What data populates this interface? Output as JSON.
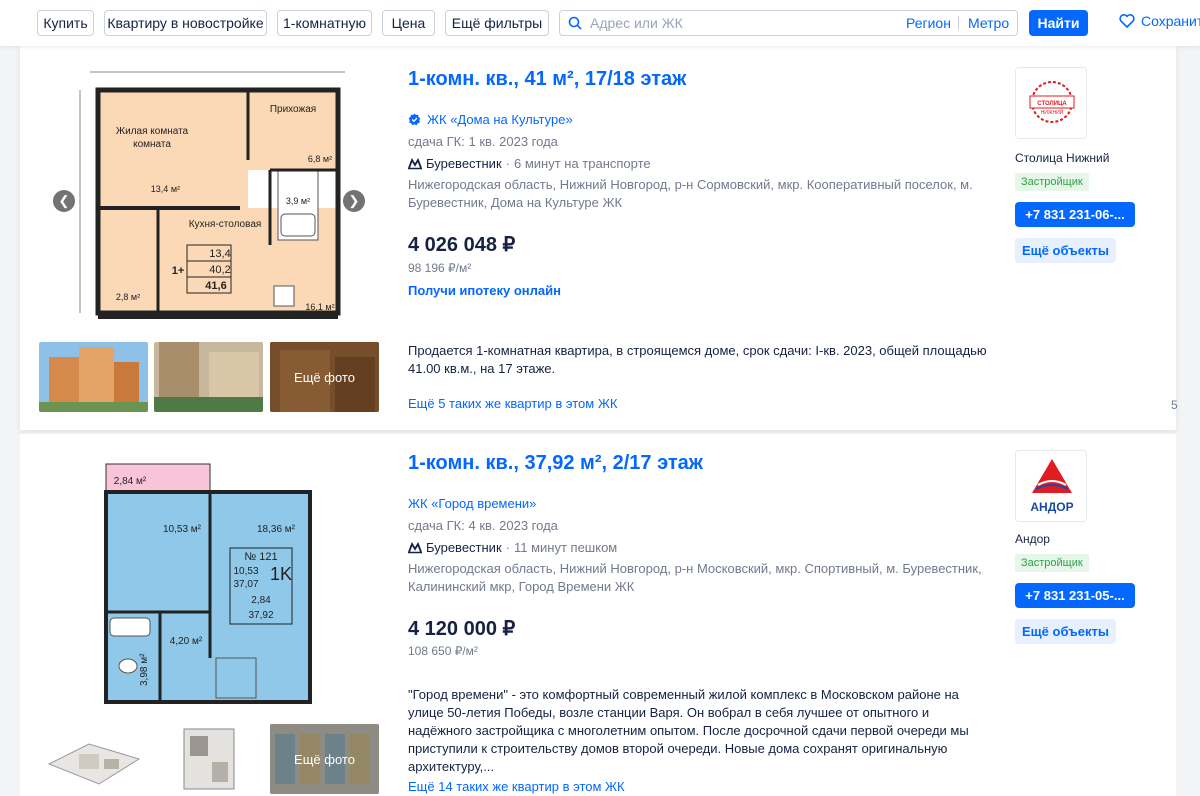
{
  "filters": {
    "buy": "Купить",
    "new_building": "Квартиру в новостройке",
    "rooms": "1-комнатную",
    "price": "Цена",
    "more_filters": "Ещё фильтры"
  },
  "search": {
    "placeholder": "Адрес или ЖК",
    "region": "Регион",
    "metro": "Метро",
    "find": "Найти"
  },
  "save_search": "Сохранить",
  "listings": [
    {
      "title": "1-комн. кв., 41 м², 17/18 этаж",
      "complex": "ЖК «Дома на Культуре»",
      "completion": "сдача ГК: 1 кв. 2023 года",
      "metro": "Буревестник",
      "metro_time": "6 минут на транспорте",
      "address": "Нижегородская область, Нижний Новгород, р-н Сормовский, мкр. Кооперативный поселок, м. Буревестник, Дома на Культуре ЖК",
      "price": "4 026 048 ₽",
      "price_per_m2": "98 196 ₽/м²",
      "mortgage_link": "Получи ипотеку онлайн",
      "description": "Продается 1-комнатная квартира, в строящемся доме, срок сдачи: I-кв. 2023, общей площадью 41.00 кв.м., на 17 этаже.",
      "more_link": "Ещё 5 таких же квартир в этом ЖК",
      "edge_number": "5",
      "more_photo": "Ещё фото",
      "developer": "Столица Нижний",
      "developer_badge": "Застройщик",
      "phone": "+7 831 231-06-...",
      "more_objects": "Ещё объекты",
      "plan": {
        "living_room": "Жилая комната",
        "living_area": "13,4 м²",
        "hallway": "Прихожая",
        "hall_area": "6,8 м²",
        "bath_area": "3,9 м²",
        "kitchen": "Кухня-столовая",
        "kitchen_area": "16,1 м²",
        "balcony_area": "2,8 м²",
        "box_1": "13,4",
        "box_rooms": "1+",
        "box_2": "40,2",
        "box_3": "41,6"
      },
      "logo_text": "СТОЛИЦА НИЖНИЙ"
    },
    {
      "title": "1-комн. кв., 37,92 м², 2/17 этаж",
      "complex": "ЖК «Город времени»",
      "completion": "сдача ГК: 4 кв. 2023 года",
      "metro": "Буревестник",
      "metro_time": "11 минут пешком",
      "address": "Нижегородская область, Нижний Новгород, р-н Московский, мкр. Спортивный, м. Буревестник, Калининский мкр, Город Времени ЖК",
      "price": "4 120 000 ₽",
      "price_per_m2": "108 650 ₽/м²",
      "description": "\"Город времени\" - это комфортный современный жилой комплекс в Московском районе на улице 50-летия Победы, возле станции Варя. Он вобрал в себя лучшее от опытного и надёжного застройщика с многолетним опытом. После досрочной сдачи первой очереди мы приступили к строительству домов второй очереди. Новые дома сохранят оригинальную архитектуру,...",
      "more_link": "Ещё 14 таких же квартир в этом ЖК",
      "more_photo": "Ещё фото",
      "developer": "Андор",
      "developer_badge": "Застройщик",
      "phone": "+7 831 231-05-...",
      "more_objects": "Ещё объекты",
      "plan": {
        "balcony": "2,84 м²",
        "room1": "10,53 м²",
        "room2": "18,36 м²",
        "hall": "4,20 м²",
        "bath": "3,98 м²",
        "num": "№ 121",
        "type": "1K",
        "v1": "10,53",
        "v2": "37,07",
        "v3": "2,84",
        "v4": "37,92"
      },
      "logo_text": "АНДОР"
    }
  ],
  "colors": {
    "accent": "#0468ff",
    "success_bg": "#e6f7e9",
    "success": "#2ea246",
    "plan_fill_1": "#fcd9b6",
    "plan_fill_2": "#8fc8e8"
  }
}
